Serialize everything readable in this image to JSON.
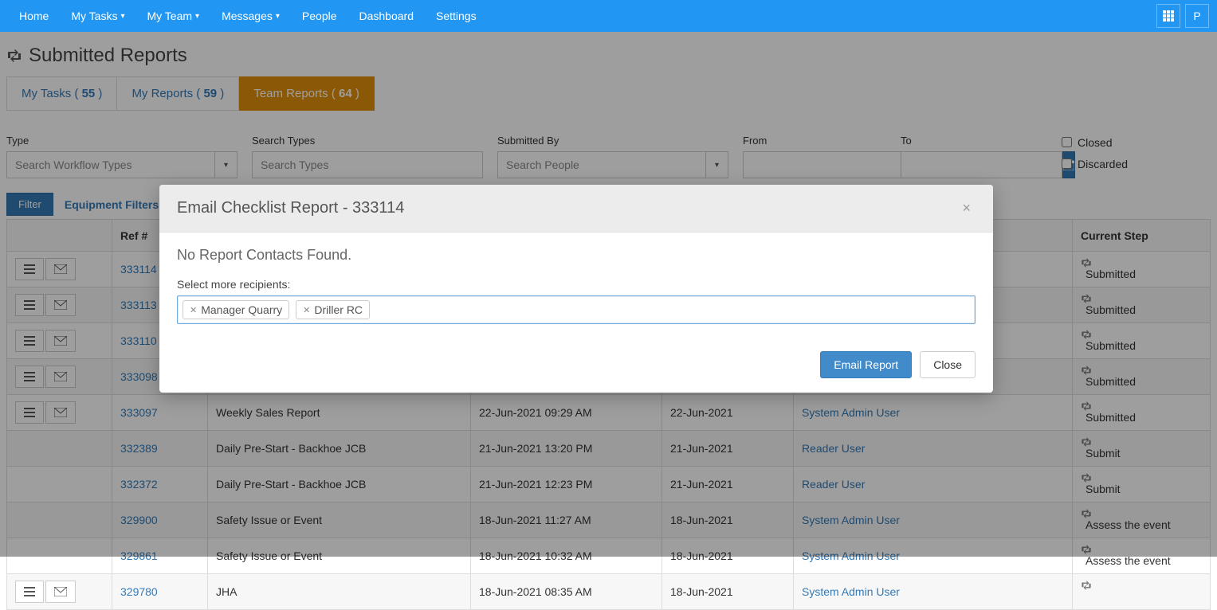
{
  "nav": {
    "left": [
      {
        "label": "Home",
        "caret": false
      },
      {
        "label": "My Tasks",
        "caret": true
      },
      {
        "label": "My Team",
        "caret": true
      },
      {
        "label": "Messages",
        "caret": true
      },
      {
        "label": "People",
        "caret": false
      },
      {
        "label": "Dashboard",
        "caret": false
      },
      {
        "label": "Settings",
        "caret": false
      }
    ],
    "right_grid": "⊞",
    "right_user_initial": "P"
  },
  "page_title": "Submitted Reports",
  "tabs": [
    {
      "label": "My Tasks",
      "count": "55",
      "active": false
    },
    {
      "label": "My Reports",
      "count": "59",
      "active": false
    },
    {
      "label": "Team Reports",
      "count": "64",
      "active": true
    }
  ],
  "filters": {
    "type_label": "Type",
    "type_placeholder": "Search Workflow Types",
    "search_types_label": "Search Types",
    "search_types_placeholder": "Search Types",
    "submitted_by_label": "Submitted By",
    "submitted_by_placeholder": "Search People",
    "from_label": "From",
    "to_label": "To",
    "closed_label": "Closed",
    "discarded_label": "Discarded",
    "filter_button": "Filter",
    "equipment_filters": "Equipment Filters"
  },
  "table": {
    "headers": {
      "actions": "",
      "ref": "Ref #",
      "type": "",
      "submitted_at": "",
      "date": "",
      "user": "",
      "step": "Current Step"
    },
    "rows": [
      {
        "ref": "333114",
        "type": "",
        "submitted_at": "",
        "date": "",
        "user": "",
        "step": "Submitted",
        "has_actions": true
      },
      {
        "ref": "333113",
        "type": "",
        "submitted_at": "",
        "date": "",
        "user": "",
        "step": "Submitted",
        "has_actions": true
      },
      {
        "ref": "333110",
        "type": "",
        "submitted_at": "",
        "date": "",
        "user": "",
        "step": "Submitted",
        "has_actions": true
      },
      {
        "ref": "333098",
        "type": "",
        "submitted_at": "",
        "date": "",
        "user": "",
        "step": "Submitted",
        "has_actions": true
      },
      {
        "ref": "333097",
        "type": "Weekly Sales Report",
        "submitted_at": "22-Jun-2021 09:29 AM",
        "date": "22-Jun-2021",
        "user": "System Admin User",
        "step": "Submitted",
        "has_actions": true
      },
      {
        "ref": "332389",
        "type": "Daily Pre-Start - Backhoe JCB",
        "submitted_at": "21-Jun-2021 13:20 PM",
        "date": "21-Jun-2021",
        "user": "Reader User",
        "step": "Submit",
        "has_actions": false
      },
      {
        "ref": "332372",
        "type": "Daily Pre-Start - Backhoe JCB",
        "submitted_at": "21-Jun-2021 12:23 PM",
        "date": "21-Jun-2021",
        "user": "Reader User",
        "step": "Submit",
        "has_actions": false
      },
      {
        "ref": "329900",
        "type": "Safety Issue or Event",
        "submitted_at": "18-Jun-2021 11:27 AM",
        "date": "18-Jun-2021",
        "user": "System Admin User",
        "step": "Assess the event",
        "has_actions": false
      },
      {
        "ref": "329861",
        "type": "Safety Issue or Event",
        "submitted_at": "18-Jun-2021 10:32 AM",
        "date": "18-Jun-2021",
        "user": "System Admin User",
        "step": "Assess the event",
        "has_actions": false
      },
      {
        "ref": "329780",
        "type": "JHA",
        "submitted_at": "18-Jun-2021 08:35 AM",
        "date": "18-Jun-2021",
        "user": "System Admin User",
        "step": "",
        "has_actions": true
      }
    ]
  },
  "modal": {
    "title": "Email Checklist Report - 333114",
    "no_contacts": "No Report Contacts Found.",
    "select_label": "Select more recipients:",
    "chips": [
      "Manager Quarry",
      "Driller RC"
    ],
    "email_button": "Email Report",
    "close_button": "Close"
  }
}
